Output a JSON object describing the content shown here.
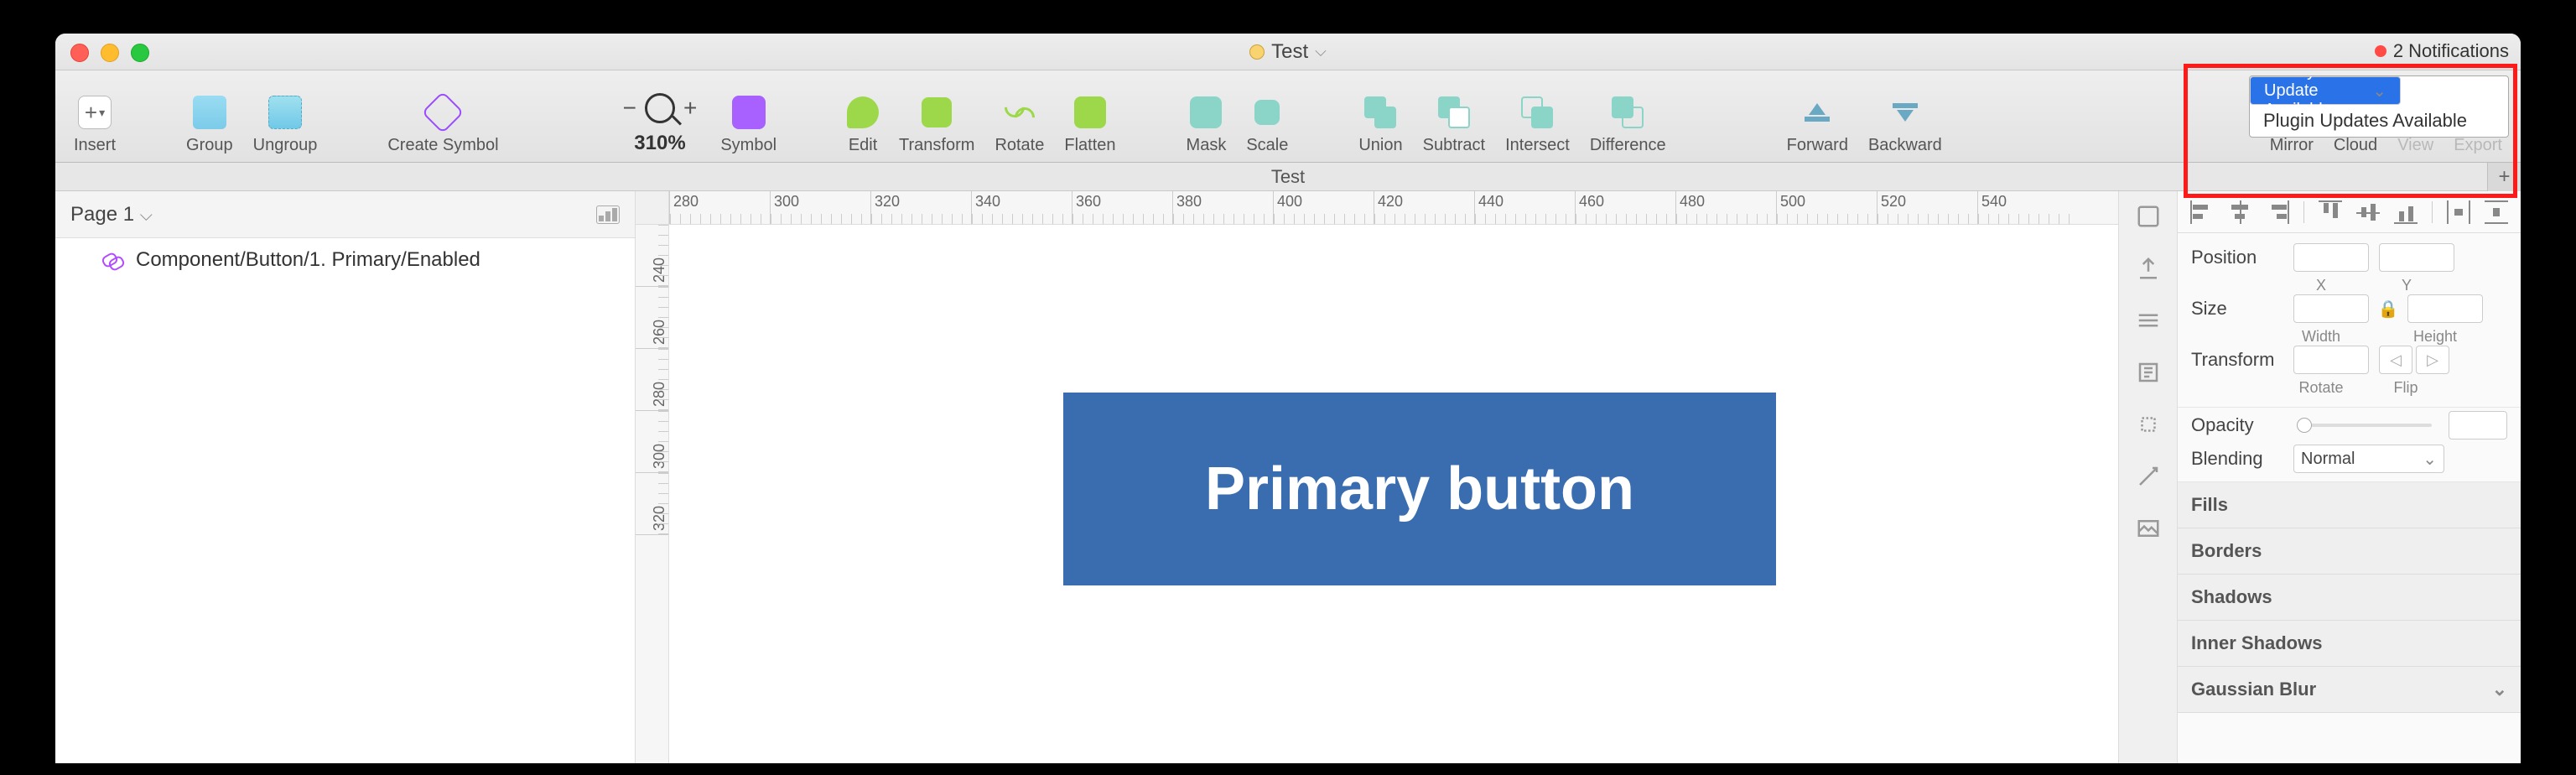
{
  "titlebar": {
    "doc_name": "Test",
    "caret": "⌵",
    "notif_count": "2 Notifications"
  },
  "notif_popup": {
    "item1": "Library Update Available",
    "item2": "Plugin Updates Available"
  },
  "toolbar": {
    "insert": "Insert",
    "group": "Group",
    "ungroup": "Ungroup",
    "create_symbol": "Create Symbol",
    "zoom": "310%",
    "symbol": "Symbol",
    "edit": "Edit",
    "transform": "Transform",
    "rotate": "Rotate",
    "flatten": "Flatten",
    "mask": "Mask",
    "scale": "Scale",
    "union": "Union",
    "subtract": "Subtract",
    "intersect": "Intersect",
    "difference": "Difference",
    "forward": "Forward",
    "backward": "Backward",
    "mirror": "Mirror",
    "cloud": "Cloud",
    "view": "View",
    "export": "Export"
  },
  "artboard_label": "Test",
  "leftpanel": {
    "page": "Page 1",
    "layer1": "Component/Button/1. Primary/Enabled"
  },
  "hruler": [
    "280",
    "300",
    "320",
    "340",
    "360",
    "380",
    "400",
    "420",
    "440",
    "460",
    "480",
    "500",
    "520",
    "540"
  ],
  "vruler": [
    "240",
    "260",
    "280",
    "300",
    "320"
  ],
  "canvas": {
    "button_text": "Primary button",
    "button_bg": "#3a6db0"
  },
  "inspector": {
    "position": "Position",
    "x": "X",
    "y": "Y",
    "size": "Size",
    "width": "Width",
    "height": "Height",
    "transform": "Transform",
    "rotate": "Rotate",
    "flip": "Flip",
    "opacity": "Opacity",
    "blending": "Blending",
    "blend_value": "Normal",
    "fills": "Fills",
    "borders": "Borders",
    "shadows": "Shadows",
    "inner_shadows": "Inner Shadows",
    "gblur": "Gaussian Blur"
  }
}
